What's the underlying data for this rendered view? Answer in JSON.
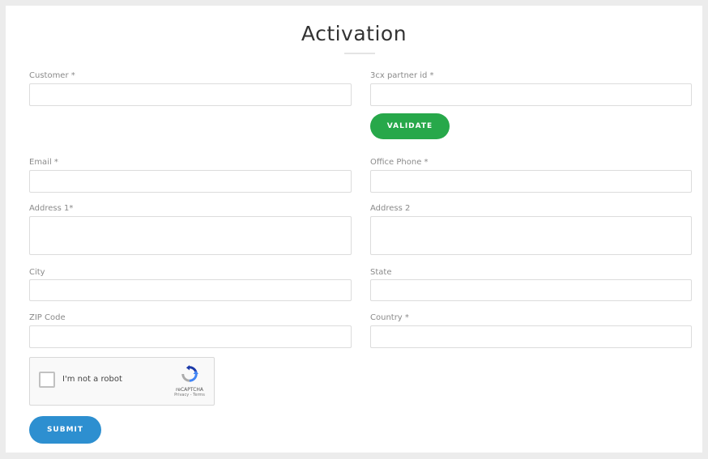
{
  "form": {
    "title": "Activation",
    "customer_label": "Customer *",
    "partner_label": "3cx partner id *",
    "validate_label": "VALIDATE",
    "email_label": "Email *",
    "office_phone_label": "Office Phone *",
    "address1_label": "Address 1*",
    "address2_label": "Address 2",
    "city_label": "City",
    "state_label": "State",
    "zip_label": "ZIP Code",
    "country_label": "Country *",
    "submit_label": "SUBMIT"
  },
  "captcha": {
    "checkbox_label": "I'm not a robot",
    "brand": "reCAPTCHA",
    "links": "Privacy - Terms"
  },
  "colors": {
    "validate": "#27a84a",
    "submit": "#2d8fd0"
  },
  "icons": {
    "captcha": "recaptcha-logo-icon"
  }
}
